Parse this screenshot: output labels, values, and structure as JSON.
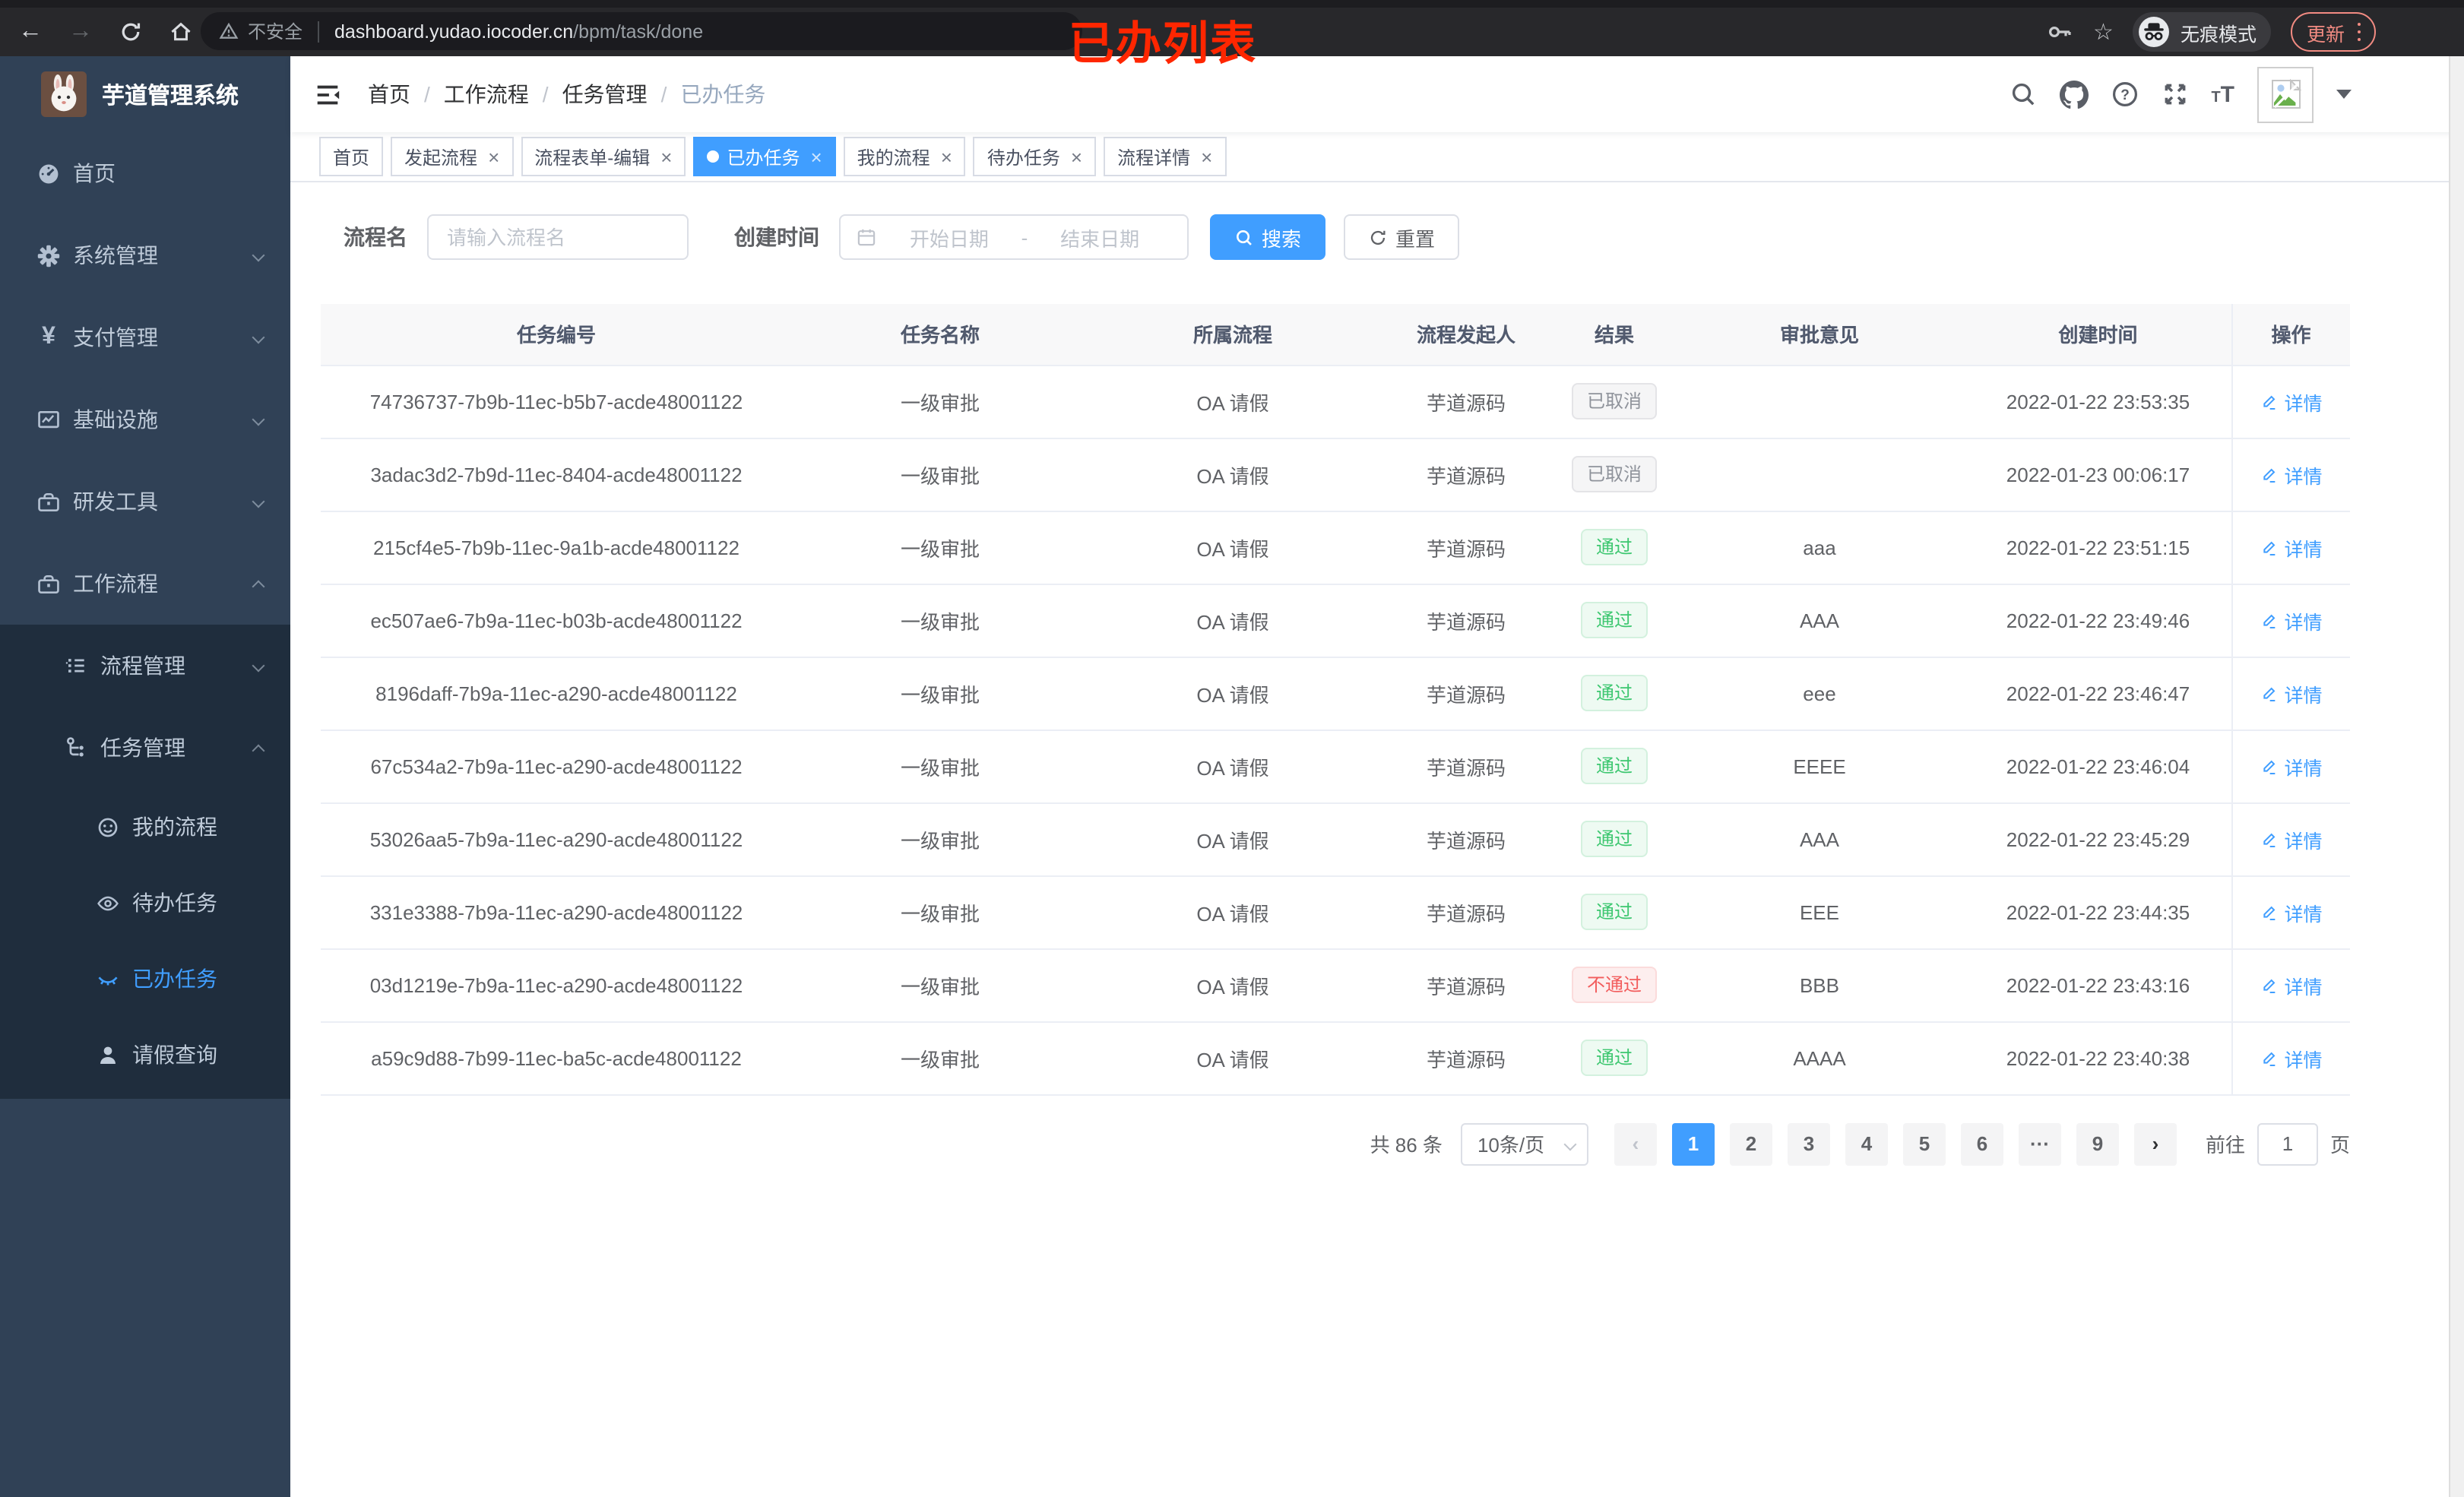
{
  "browser": {
    "security_label": "不安全",
    "url_host": "dashboard.yudao.iocoder.cn",
    "url_path": "/bpm/task/done",
    "incognito_label": "无痕模式",
    "update_button": "更新"
  },
  "annotation": {
    "text": "已办列表",
    "color": "#ff2600"
  },
  "sidebar": {
    "title": "芋道管理系统",
    "menu": [
      {
        "label": "首页"
      },
      {
        "label": "系统管理"
      },
      {
        "label": "支付管理"
      },
      {
        "label": "基础设施"
      },
      {
        "label": "研发工具"
      },
      {
        "label": "工作流程"
      }
    ],
    "submenu": [
      {
        "label": "流程管理"
      },
      {
        "label": "任务管理"
      }
    ],
    "task_children": [
      {
        "label": "我的流程"
      },
      {
        "label": "待办任务"
      },
      {
        "label": "已办任务",
        "active": true
      },
      {
        "label": "请假查询"
      }
    ]
  },
  "header": {
    "breadcrumb": [
      "首页",
      "工作流程",
      "任务管理",
      "已办任务"
    ],
    "separator": "/"
  },
  "tabs": [
    {
      "label": "首页",
      "closable": false
    },
    {
      "label": "发起流程",
      "closable": true
    },
    {
      "label": "流程表单-编辑",
      "closable": true
    },
    {
      "label": "已办任务",
      "closable": true,
      "active": true
    },
    {
      "label": "我的流程",
      "closable": true
    },
    {
      "label": "待办任务",
      "closable": true
    },
    {
      "label": "流程详情",
      "closable": true
    }
  ],
  "filters": {
    "name_label": "流程名",
    "name_placeholder": "请输入流程名",
    "time_label": "创建时间",
    "start_placeholder": "开始日期",
    "range_separator": "-",
    "end_placeholder": "结束日期",
    "search_button": "搜索",
    "reset_button": "重置"
  },
  "table": {
    "columns": [
      "任务编号",
      "任务名称",
      "所属流程",
      "流程发起人",
      "结果",
      "审批意见",
      "创建时间",
      "操作"
    ],
    "action_label": "详情",
    "rows": [
      {
        "id": "74736737-7b9b-11ec-b5b7-acde48001122",
        "name": "一级审批",
        "process": "OA 请假",
        "starter": "芋道源码",
        "result": {
          "label": "已取消",
          "type": "info"
        },
        "comment": "",
        "time": "2022-01-22 23:53:35"
      },
      {
        "id": "3adac3d2-7b9d-11ec-8404-acde48001122",
        "name": "一级审批",
        "process": "OA 请假",
        "starter": "芋道源码",
        "result": {
          "label": "已取消",
          "type": "info"
        },
        "comment": "",
        "time": "2022-01-23 00:06:17"
      },
      {
        "id": "215cf4e5-7b9b-11ec-9a1b-acde48001122",
        "name": "一级审批",
        "process": "OA 请假",
        "starter": "芋道源码",
        "result": {
          "label": "通过",
          "type": "success"
        },
        "comment": "aaa",
        "time": "2022-01-22 23:51:15"
      },
      {
        "id": "ec507ae6-7b9a-11ec-b03b-acde48001122",
        "name": "一级审批",
        "process": "OA 请假",
        "starter": "芋道源码",
        "result": {
          "label": "通过",
          "type": "success"
        },
        "comment": "AAA",
        "time": "2022-01-22 23:49:46"
      },
      {
        "id": "8196daff-7b9a-11ec-a290-acde48001122",
        "name": "一级审批",
        "process": "OA 请假",
        "starter": "芋道源码",
        "result": {
          "label": "通过",
          "type": "success"
        },
        "comment": "eee",
        "time": "2022-01-22 23:46:47"
      },
      {
        "id": "67c534a2-7b9a-11ec-a290-acde48001122",
        "name": "一级审批",
        "process": "OA 请假",
        "starter": "芋道源码",
        "result": {
          "label": "通过",
          "type": "success"
        },
        "comment": "EEEE",
        "time": "2022-01-22 23:46:04"
      },
      {
        "id": "53026aa5-7b9a-11ec-a290-acde48001122",
        "name": "一级审批",
        "process": "OA 请假",
        "starter": "芋道源码",
        "result": {
          "label": "通过",
          "type": "success"
        },
        "comment": "AAA",
        "time": "2022-01-22 23:45:29"
      },
      {
        "id": "331e3388-7b9a-11ec-a290-acde48001122",
        "name": "一级审批",
        "process": "OA 请假",
        "starter": "芋道源码",
        "result": {
          "label": "通过",
          "type": "success"
        },
        "comment": "EEE",
        "time": "2022-01-22 23:44:35"
      },
      {
        "id": "03d1219e-7b9a-11ec-a290-acde48001122",
        "name": "一级审批",
        "process": "OA 请假",
        "starter": "芋道源码",
        "result": {
          "label": "不通过",
          "type": "danger"
        },
        "comment": "BBB",
        "time": "2022-01-22 23:43:16"
      },
      {
        "id": "a59c9d88-7b99-11ec-ba5c-acde48001122",
        "name": "一级审批",
        "process": "OA 请假",
        "starter": "芋道源码",
        "result": {
          "label": "通过",
          "type": "success"
        },
        "comment": "AAAA",
        "time": "2022-01-22 23:40:38"
      }
    ]
  },
  "pagination": {
    "total": "共 86 条",
    "page_size": "10条/页",
    "prev": "‹",
    "pages": [
      "1",
      "2",
      "3",
      "4",
      "5",
      "6",
      "···",
      "9"
    ],
    "active_page": "1",
    "next": "›",
    "goto_label": "前往",
    "goto_value": "1",
    "goto_unit": "页"
  },
  "colors": {
    "accent": "#409eff",
    "sidebar_bg": "#304156",
    "submenu_bg": "#1f2d3d",
    "success": "#3dc770",
    "danger": "#f25c5c",
    "info": "#909399",
    "annotation": "#ff2600",
    "update_button": "#f28b82"
  }
}
